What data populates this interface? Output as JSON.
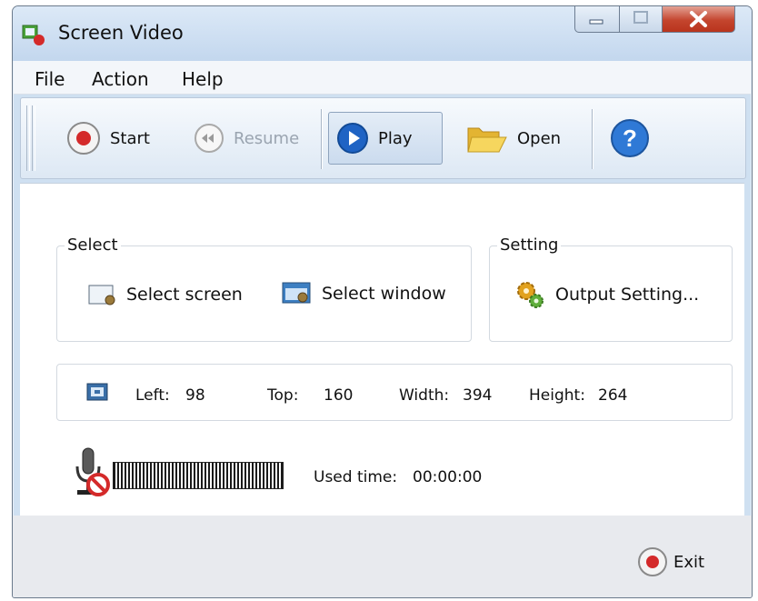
{
  "window": {
    "title": "Screen Video"
  },
  "menu": [
    "File",
    "Action",
    "Help"
  ],
  "toolbar": {
    "start_label": "Start",
    "resume_label": "Resume",
    "play_label": "Play",
    "open_label": "Open"
  },
  "select_group": {
    "title": "Select",
    "select_screen": "Select screen",
    "select_window": "Select window"
  },
  "setting_group": {
    "title": "Setting",
    "output_setting": "Output Setting..."
  },
  "region": {
    "left_label": "Left:",
    "left_value": "98",
    "top_label": "Top:",
    "top_value": "160",
    "width_label": "Width:",
    "width_value": "394",
    "height_label": "Height:",
    "height_value": "264"
  },
  "status": {
    "used_time_label": "Used time:",
    "used_time_value": "00:00:00"
  },
  "footer": {
    "exit_label": "Exit"
  },
  "colors": {
    "accent_red": "#d42a2a",
    "play_blue": "#1f63c4",
    "help_blue": "#2f79d6"
  }
}
